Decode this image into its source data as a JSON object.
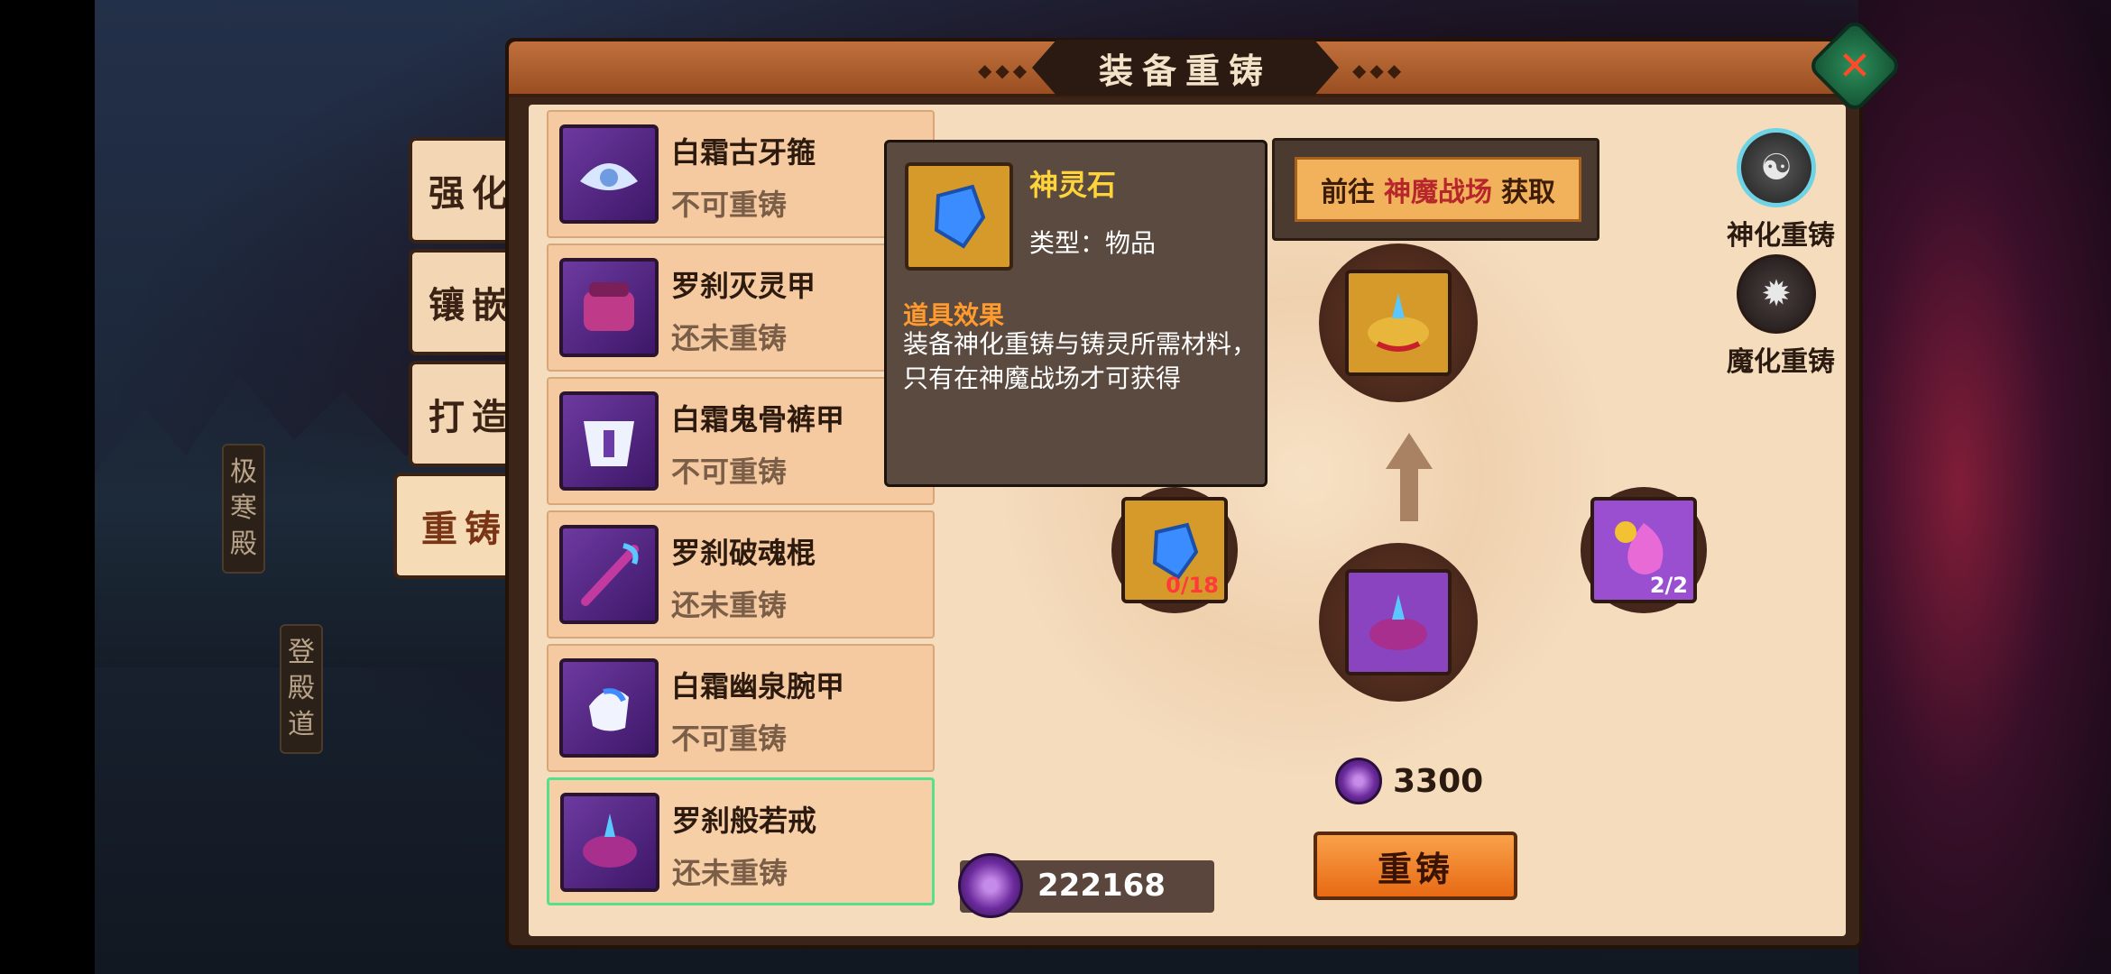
{
  "window": {
    "title": "装备重铸"
  },
  "map_tags": [
    "极寒殿",
    "登殿道"
  ],
  "nav_tabs": [
    {
      "label": "强化"
    },
    {
      "label": "镶嵌"
    },
    {
      "label": "打造"
    },
    {
      "label": "重铸"
    }
  ],
  "equipment_list": [
    {
      "name": "白霜古牙箍",
      "status": "不可重铸",
      "icon": "white-frost-helmet-icon"
    },
    {
      "name": "罗刹灭灵甲",
      "status": "还未重铸",
      "icon": "rakshasa-armor-icon"
    },
    {
      "name": "白霜鬼骨裤甲",
      "status": "不可重铸",
      "icon": "white-frost-leg-armor-icon"
    },
    {
      "name": "罗刹破魂棍",
      "status": "还未重铸",
      "icon": "rakshasa-staff-icon"
    },
    {
      "name": "白霜幽泉腕甲",
      "status": "不可重铸",
      "icon": "white-frost-bracer-icon"
    },
    {
      "name": "罗刹般若戒",
      "status": "还未重铸",
      "icon": "rakshasa-ring-icon",
      "selected": true
    }
  ],
  "tooltip": {
    "item_name": "神灵石",
    "type": "类型：物品",
    "effect_label": "道具效果",
    "effect_desc": "装备神化重铸与铸灵所需材料，只有在神魔战场才可获得"
  },
  "goto": {
    "prefix": "前往",
    "place": "神魔战场",
    "suffix": "获取"
  },
  "modes": [
    {
      "label": "神化重铸",
      "icon": "divine-reforge-icon"
    },
    {
      "label": "魔化重铸",
      "icon": "demonic-reforge-icon"
    }
  ],
  "materials": [
    {
      "name": "神灵石",
      "count": "0/18",
      "icon": "spirit-stone-icon"
    },
    {
      "name": "魂火",
      "count": "2/2",
      "icon": "soul-flame-icon"
    }
  ],
  "cost": {
    "value": "3300"
  },
  "actions": {
    "reforge_label": "重铸"
  },
  "currency": {
    "value": "222168"
  },
  "colors": {
    "accent": "#e86a14",
    "selected_border": "#55e08c",
    "highlight": "#ffd43a"
  }
}
